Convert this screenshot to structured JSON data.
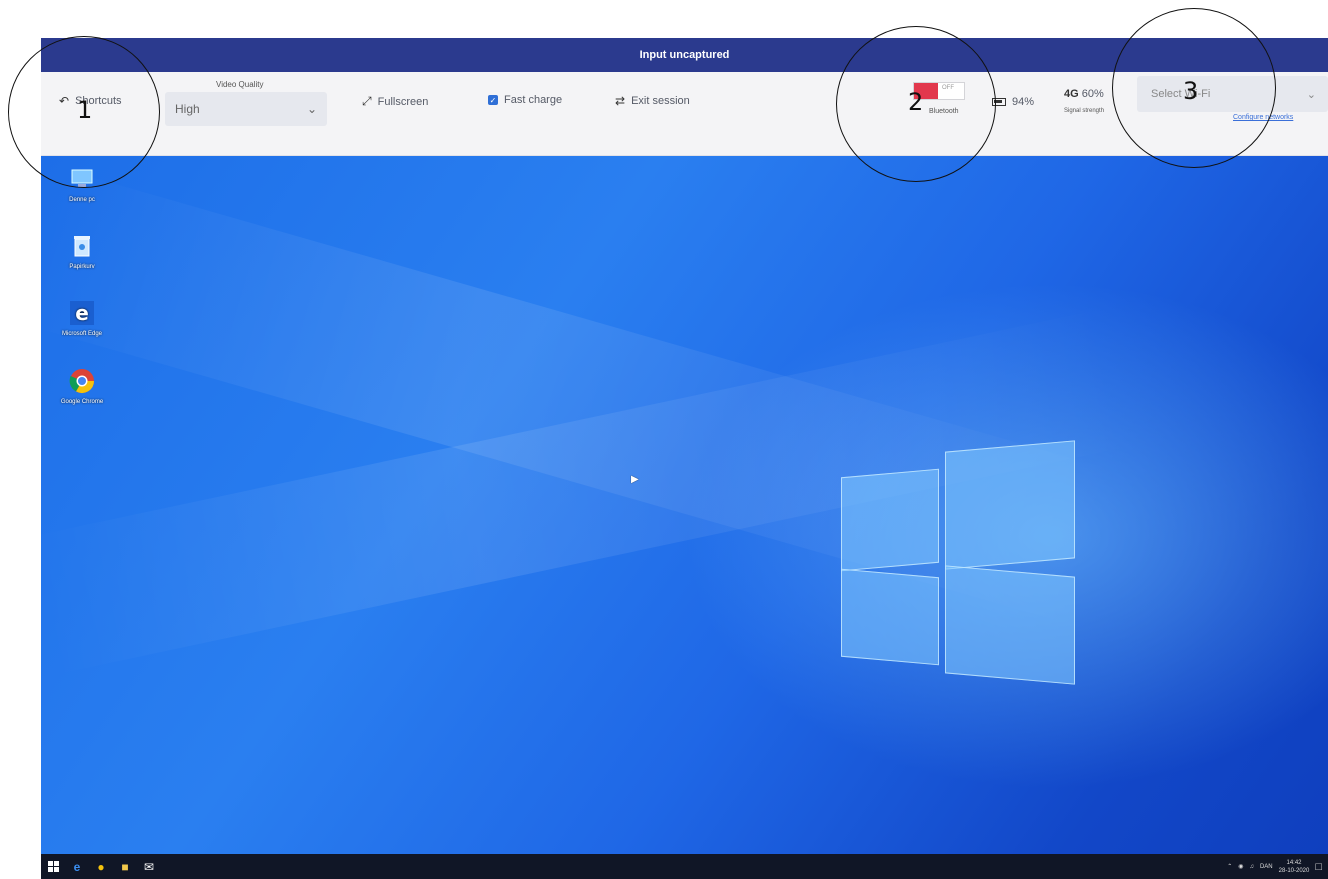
{
  "titlebar": {
    "text": "Input uncaptured"
  },
  "toolbar": {
    "shortcuts_label": "Shortcuts",
    "video_quality_label": "Video Quality",
    "video_quality_value": "High",
    "fullscreen_label": "Fullscreen",
    "fast_charge_label": "Fast charge",
    "fast_charge_checked": true,
    "exit_label": "Exit session",
    "bluetooth_state": "OFF",
    "bluetooth_label": "Bluetooth",
    "battery_percent": "94%",
    "signal_tech": "4G",
    "signal_percent": "60%",
    "signal_label": "Signal strength",
    "wifi_placeholder": "Select Wi-Fi",
    "configure_networks": "Configure networks"
  },
  "desktop": {
    "icons": [
      {
        "label": "Denne pc",
        "icon": "computer-icon"
      },
      {
        "label": "Papirkurv",
        "icon": "recycle-bin-icon"
      },
      {
        "label": "Microsoft Edge",
        "icon": "edge-icon"
      },
      {
        "label": "Google Chrome",
        "icon": "chrome-icon"
      }
    ]
  },
  "taskbar": {
    "language": "DAN",
    "time": "14:42",
    "date": "28-10-2020"
  },
  "annotations": [
    "1",
    "2",
    "3"
  ],
  "colors": {
    "titlebar": "#2b3a8e",
    "bluetooth_off": "#e2384d",
    "link": "#3a6fd8"
  }
}
